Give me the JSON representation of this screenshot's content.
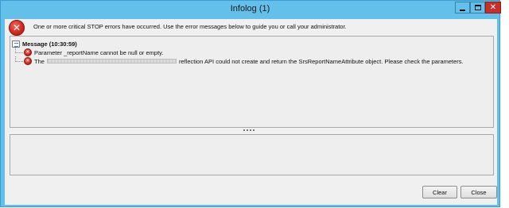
{
  "window": {
    "title": "Infolog (1)",
    "min_icon": "minimize-icon",
    "max_icon": "maximize-icon",
    "close_icon": "close-icon",
    "close_glyph": "✕",
    "accent_color": "#63c0ea",
    "close_color": "#c7302a"
  },
  "header": {
    "icon": "critical-error-icon",
    "icon_glyph": "✕",
    "message": "One or more critical STOP errors have occurred. Use the error messages below to guide you or call your administrator."
  },
  "tree": {
    "root": {
      "icon": "message-icon",
      "label": "Message (10:30:59)"
    },
    "items": [
      {
        "icon": "error-icon",
        "glyph": "✕",
        "text": "Parameter _reportName cannot be null or empty."
      },
      {
        "icon": "error-icon",
        "glyph": "✕",
        "text_before": "The",
        "text_after": "reflection API could not create and return the SrsReportNameAttribute object. Please check the parameters."
      }
    ]
  },
  "buttons": {
    "clear": "Clear",
    "close": "Close"
  }
}
